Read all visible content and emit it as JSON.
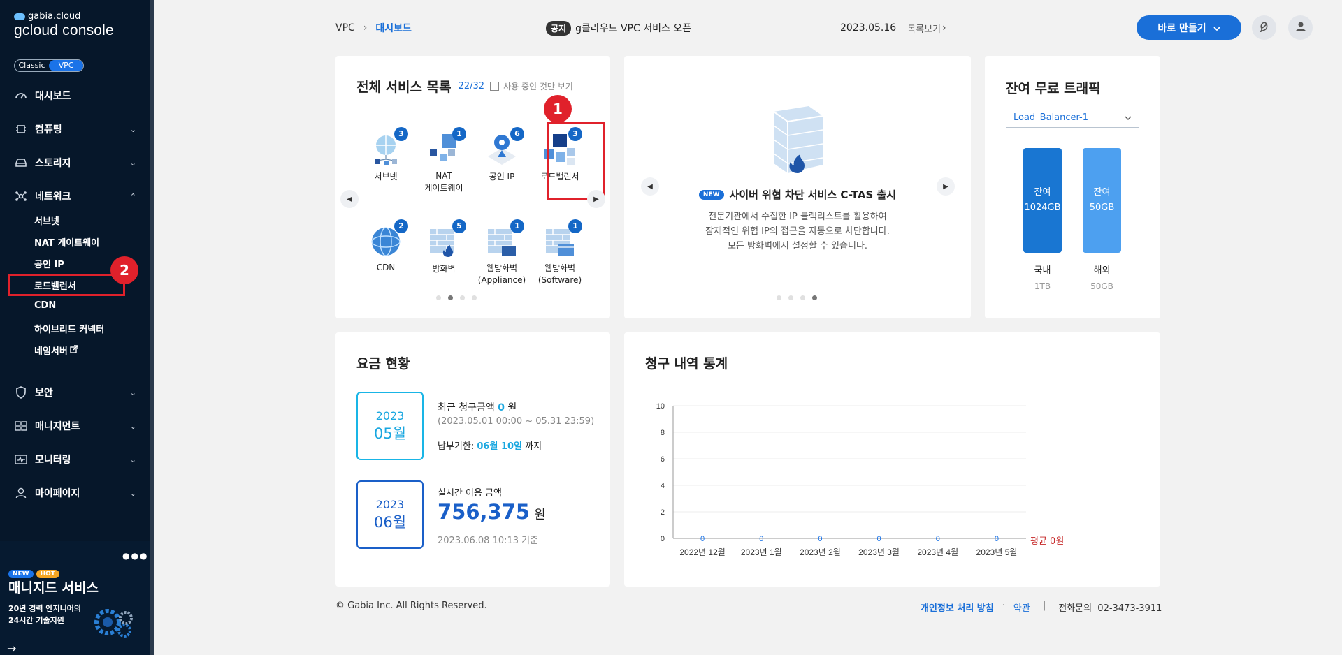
{
  "sidebar": {
    "brand_top": "gabia.cloud",
    "brand_main": "gcloud console",
    "toggle": {
      "classic": "Classic",
      "vpc": "VPC"
    },
    "items": [
      {
        "label": "대시보드",
        "icon": "dashboard-icon",
        "chev": ""
      },
      {
        "label": "컴퓨팅",
        "icon": "chip-icon",
        "chev": "⌄"
      },
      {
        "label": "스토리지",
        "icon": "storage-icon",
        "chev": "⌄"
      },
      {
        "label": "네트워크",
        "icon": "network-icon",
        "chev": "⌃"
      },
      {
        "label": "보안",
        "icon": "shield-icon",
        "chev": "⌄"
      },
      {
        "label": "매니지먼트",
        "icon": "management-icon",
        "chev": "⌄"
      },
      {
        "label": "모니터링",
        "icon": "monitor-icon",
        "chev": "⌄"
      },
      {
        "label": "마이페이지",
        "icon": "user-icon",
        "chev": "⌄"
      }
    ],
    "subitems": [
      "서브넷",
      "NAT 게이트웨이",
      "공인 IP",
      "로드밸런서",
      "CDN",
      "하이브리드 커넥터",
      "네임서버"
    ],
    "marker_2": "2",
    "promo": {
      "tag_new": "NEW",
      "tag_hot": "HOT",
      "title": "매니지드 서비스",
      "line1": "20년 경력 엔지니어의",
      "line2": "24시간 기술지원",
      "dots": "●●●",
      "arrow": "→"
    }
  },
  "header": {
    "breadcrumb_root": "VPC",
    "breadcrumb_sep": "›",
    "breadcrumb_current": "대시보드",
    "notice_badge": "공지",
    "notice_text": "g클라우드 VPC 서비스 오픈",
    "notice_date": "2023.05.16",
    "notice_more": "목록보기",
    "create_button": "바로 만들기"
  },
  "services": {
    "title": "전체 서비스 목록",
    "count": "22/32",
    "filter_label": "사용 중인 것만 보기",
    "marker_1": "1",
    "items": [
      {
        "label": "서브넷",
        "count": "3"
      },
      {
        "label": "NAT\n게이트웨이",
        "count": "1"
      },
      {
        "label": "공인 IP",
        "count": "6"
      },
      {
        "label": "로드밸런서",
        "count": "3"
      },
      {
        "label": "CDN",
        "count": "2"
      },
      {
        "label": "방화벽",
        "count": "5"
      },
      {
        "label": "웹방화벽\n(Appliance)",
        "count": "1"
      },
      {
        "label": "웹방화벽\n(Software)",
        "count": "1"
      }
    ]
  },
  "banner": {
    "new_tag": "NEW",
    "title": "사이버 위협 차단 서비스 C-TAS 출시",
    "line1": "전문기관에서 수집한 IP 블랙리스트를 활용하여",
    "line2": "잠재적인 위협 IP의 접근을 자동으로 차단합니다.",
    "line3": "모든 방화벽에서 설정할 수 있습니다."
  },
  "traffic": {
    "title": "잔여 무료 트래픽",
    "select_value": "Load_Balancer-1",
    "bars": [
      {
        "label": "잔여\n1024GB",
        "name": "국내",
        "total": "1TB",
        "color": "#1976d2"
      },
      {
        "label": "잔여\n50GB",
        "name": "해외",
        "total": "50GB",
        "color": "#4da0f0"
      }
    ]
  },
  "billing": {
    "title": "요금 현황",
    "box1": {
      "year": "2023",
      "month": "05월"
    },
    "recent_label": "최근 청구금액",
    "recent_amount": "0",
    "recent_unit": "원",
    "period": "(2023.05.01 00:00 ~ 05.31 23:59)",
    "due_label": "납부기한:",
    "due_date": "06월 10일",
    "due_suffix": "까지",
    "box2": {
      "year": "2023",
      "month": "06월"
    },
    "realtime_label": "실시간 이용 금액",
    "realtime_amount": "756,375",
    "realtime_unit": "원",
    "realtime_time": "2023.06.08 10:13 기준"
  },
  "stats": {
    "title": "청구 내역 통계",
    "avg_label": "평균 0원"
  },
  "chart_data": {
    "type": "bar",
    "categories": [
      "2022년 12월",
      "2023년 1월",
      "2023년 2월",
      "2023년 3월",
      "2023년 4월",
      "2023년 5월"
    ],
    "values": [
      0,
      0,
      0,
      0,
      0,
      0
    ],
    "yticks": [
      0,
      2,
      4,
      6,
      8,
      10
    ],
    "ylim": [
      0,
      10
    ],
    "title": "",
    "xlabel": "",
    "ylabel": "",
    "grid": true,
    "accent": "#1a73e8",
    "avg_color": "#c62828"
  },
  "footer": {
    "copyright": "© Gabia Inc. All Rights Reserved.",
    "privacy": "개인정보 처리 방침",
    "dot": "·",
    "terms": "약관",
    "bar": "|",
    "phone": "전화문의  02-3473-3911"
  }
}
